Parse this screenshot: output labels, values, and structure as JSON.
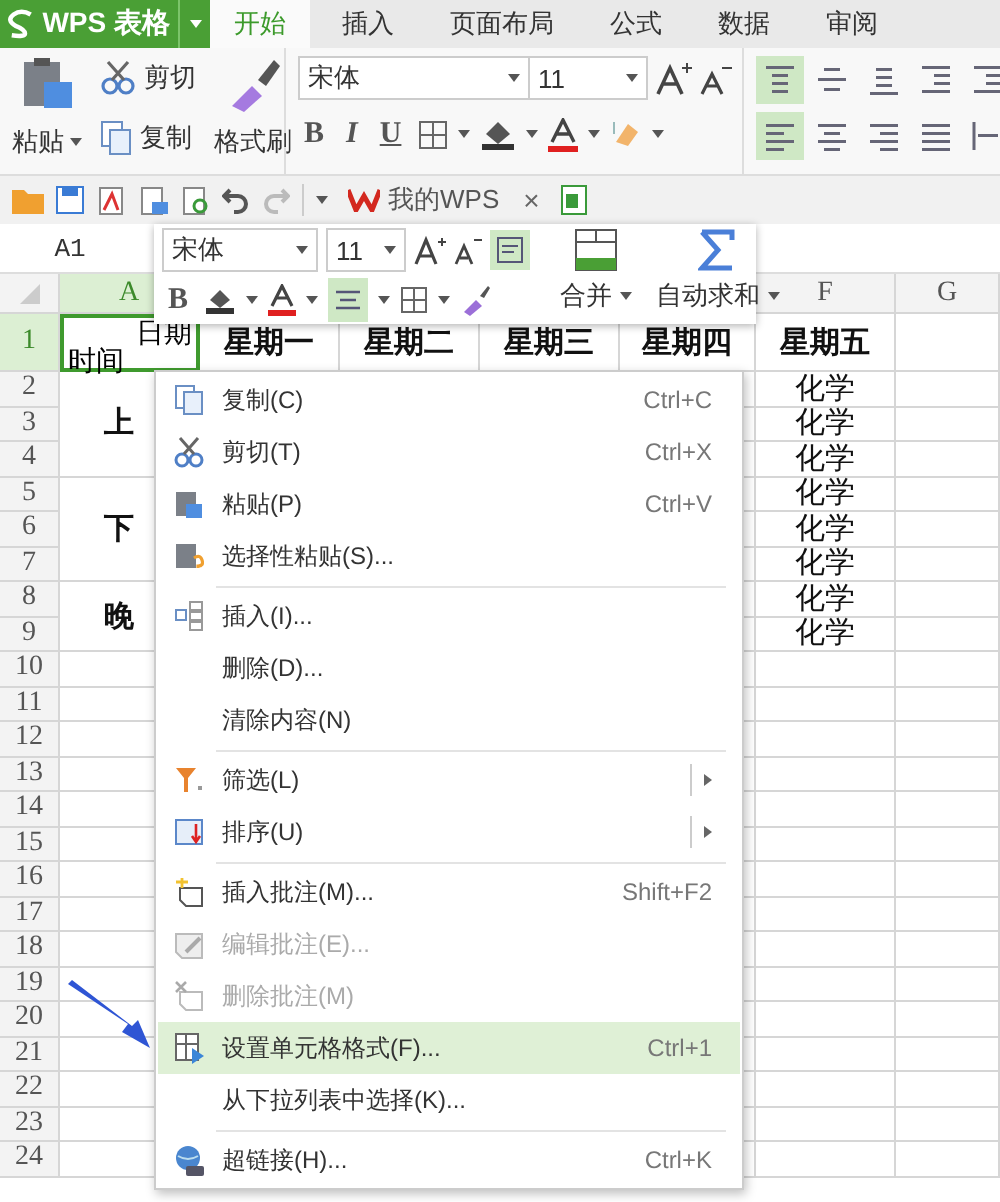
{
  "app_button": {
    "label": "WPS 表格"
  },
  "ribbon_tabs": [
    {
      "label": "开始",
      "selected": true
    },
    {
      "label": "插入",
      "selected": false
    },
    {
      "label": "页面布局",
      "selected": false
    },
    {
      "label": "公式",
      "selected": false
    },
    {
      "label": "数据",
      "selected": false
    },
    {
      "label": "审阅",
      "selected": false
    }
  ],
  "clipboard": {
    "paste": "粘贴",
    "cut": "剪切",
    "copy": "复制",
    "format_painter": "格式刷"
  },
  "font": {
    "name": "宋体",
    "size": "11",
    "bold": "B",
    "italic": "I",
    "underline": "U"
  },
  "alignment": [
    {
      "kind": "top",
      "selected": true
    },
    {
      "kind": "middle",
      "selected": false
    },
    {
      "kind": "bottom",
      "selected": false
    },
    {
      "kind": "outdent",
      "selected": false
    },
    {
      "kind": "indent",
      "selected": false
    },
    {
      "kind": "left",
      "selected": true
    },
    {
      "kind": "center",
      "selected": false
    },
    {
      "kind": "right",
      "selected": false
    },
    {
      "kind": "justify",
      "selected": false
    },
    {
      "kind": "distributed",
      "selected": false
    }
  ],
  "doc_tab": {
    "label": "我的WPS",
    "close": "×"
  },
  "name_box": "A1",
  "mini_toolbar": {
    "font": "宋体",
    "size": "11",
    "bold": "B",
    "wrap_selected": true,
    "center_selected": true,
    "merge": "合并",
    "autosum": "自动求和"
  },
  "columns": [
    {
      "label": "A",
      "selected": true
    },
    {
      "label": "F",
      "selected": false
    },
    {
      "label": "G",
      "selected": false
    }
  ],
  "rows": [
    {
      "label": "1",
      "selected": true
    },
    {
      "label": "2",
      "selected": false
    },
    {
      "label": "3",
      "selected": false
    },
    {
      "label": "4",
      "selected": false
    },
    {
      "label": "5",
      "selected": false
    },
    {
      "label": "6",
      "selected": false
    },
    {
      "label": "7",
      "selected": false
    },
    {
      "label": "8",
      "selected": false
    },
    {
      "label": "9",
      "selected": false
    },
    {
      "label": "10",
      "selected": false
    },
    {
      "label": "11",
      "selected": false
    },
    {
      "label": "12",
      "selected": false
    },
    {
      "label": "13",
      "selected": false
    },
    {
      "label": "14",
      "selected": false
    },
    {
      "label": "15",
      "selected": false
    },
    {
      "label": "16",
      "selected": false
    },
    {
      "label": "17",
      "selected": false
    },
    {
      "label": "18",
      "selected": false
    },
    {
      "label": "19",
      "selected": false
    },
    {
      "label": "20",
      "selected": false
    },
    {
      "label": "21",
      "selected": false
    },
    {
      "label": "22",
      "selected": false
    },
    {
      "label": "23",
      "selected": false
    },
    {
      "label": "24",
      "selected": false
    }
  ],
  "header_cell": {
    "top": "日期",
    "bottom": "时间"
  },
  "day_headers": [
    "星期一",
    "星期二",
    "星期三",
    "星期四",
    "星期五"
  ],
  "periods": [
    "上",
    "下",
    "晚"
  ],
  "friday_subjects": [
    "化学",
    "化学",
    "化学",
    "化学",
    "化学",
    "化学",
    "化学",
    "化学"
  ],
  "context_menu": {
    "items": [
      {
        "kind": "command",
        "label": "复制(C)",
        "shortcut": "Ctrl+C",
        "submenu": false,
        "disabled": false,
        "selected": false
      },
      {
        "kind": "command",
        "label": "剪切(T)",
        "shortcut": "Ctrl+X",
        "submenu": false,
        "disabled": false,
        "selected": false
      },
      {
        "kind": "command",
        "label": "粘贴(P)",
        "shortcut": "Ctrl+V",
        "submenu": false,
        "disabled": false,
        "selected": false
      },
      {
        "kind": "command",
        "label": "选择性粘贴(S)...",
        "submenu": false,
        "disabled": false,
        "selected": false
      },
      {
        "kind": "separator"
      },
      {
        "kind": "command",
        "label": "插入(I)...",
        "submenu": false,
        "disabled": false,
        "selected": false
      },
      {
        "kind": "command",
        "label": "删除(D)...",
        "submenu": false,
        "disabled": false,
        "selected": false
      },
      {
        "kind": "command",
        "label": "清除内容(N)",
        "submenu": false,
        "disabled": false,
        "selected": false
      },
      {
        "kind": "separator"
      },
      {
        "kind": "command",
        "label": "筛选(L)",
        "submenu": true,
        "disabled": false,
        "selected": false
      },
      {
        "kind": "command",
        "label": "排序(U)",
        "submenu": true,
        "disabled": false,
        "selected": false
      },
      {
        "kind": "separator"
      },
      {
        "kind": "command",
        "label": "插入批注(M)...",
        "shortcut": "Shift+F2",
        "submenu": false,
        "disabled": false,
        "selected": false
      },
      {
        "kind": "command",
        "label": "编辑批注(E)...",
        "submenu": false,
        "disabled": true,
        "selected": false
      },
      {
        "kind": "command",
        "label": "删除批注(M)",
        "submenu": false,
        "disabled": true,
        "selected": false
      },
      {
        "kind": "command",
        "label": "设置单元格格式(F)...",
        "shortcut": "Ctrl+1",
        "submenu": false,
        "disabled": false,
        "selected": true
      },
      {
        "kind": "command",
        "label": "从下拉列表中选择(K)...",
        "submenu": false,
        "disabled": false,
        "selected": false
      },
      {
        "kind": "separator"
      },
      {
        "kind": "command",
        "label": "超链接(H)...",
        "shortcut": "Ctrl+K",
        "submenu": false,
        "disabled": false,
        "selected": false
      }
    ]
  }
}
